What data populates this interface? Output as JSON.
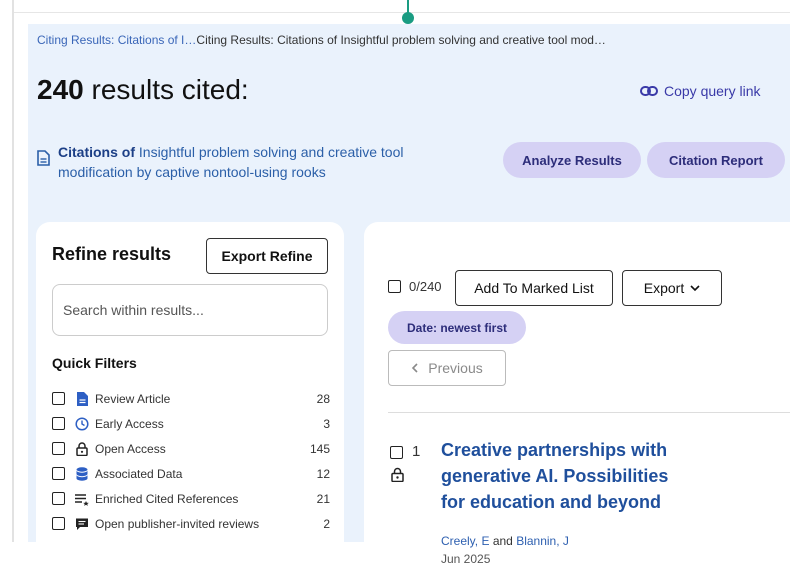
{
  "breadcrumb": {
    "link": "Citing Results: Citations of I…",
    "current": "Citing Results: Citations of Insightful problem solving and creative tool mod…"
  },
  "summary": {
    "count": "240",
    "suffix": "results cited:",
    "copy_link_label": "Copy query link"
  },
  "citation": {
    "prefix": "Citations of",
    "title": "Insightful problem solving and creative tool modification by captive nontool-using rooks"
  },
  "actions": {
    "analyze": "Analyze Results",
    "report": "Citation Report"
  },
  "refine": {
    "title": "Refine results",
    "export_label": "Export Refine",
    "search_placeholder": "Search within results...",
    "quick_filters_title": "Quick Filters",
    "filters": [
      {
        "label": "Review Article",
        "count": "28",
        "icon": "document-icon"
      },
      {
        "label": "Early Access",
        "count": "3",
        "icon": "clock-icon"
      },
      {
        "label": "Open Access",
        "count": "145",
        "icon": "unlock-icon"
      },
      {
        "label": "Associated Data",
        "count": "12",
        "icon": "database-icon"
      },
      {
        "label": "Enriched Cited References",
        "count": "21",
        "icon": "enriched-list-icon"
      },
      {
        "label": "Open publisher-invited reviews",
        "count": "2",
        "icon": "review-chat-icon"
      }
    ]
  },
  "results": {
    "selected_count": "0/240",
    "add_to_marked": "Add To Marked List",
    "export_label": "Export",
    "sort_label": "Date: newest first",
    "previous_label": "Previous",
    "records": [
      {
        "index": "1",
        "title": "Creative partnerships with generative AI. Possibilities for education and beyond",
        "author1": "Creely, E",
        "author_sep": "and",
        "author2": "Blannin, J",
        "date": "Jun 2025"
      }
    ]
  },
  "colors": {
    "band": "#eaf2fc",
    "pill": "#d5d1f4",
    "link": "#1f4f9c",
    "pin": "#1a9c82"
  }
}
